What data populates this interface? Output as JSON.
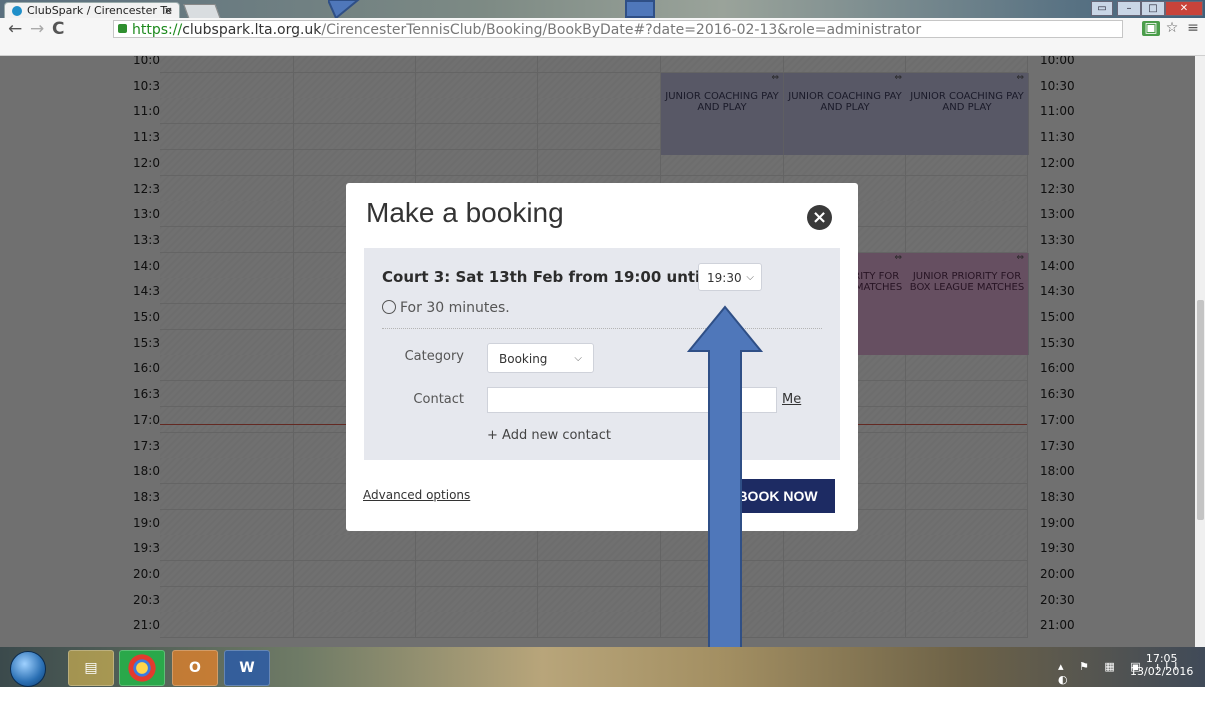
{
  "browser": {
    "tab_title": "ClubSpark / Cirencester Te",
    "tab_close": "×",
    "url_https": "https://",
    "url_domain": "clubspark.lta.org.uk",
    "url_path": "/CirencesterTennisClub/Booking/BookByDate#?date=2016-02-13&role=administrator"
  },
  "timetable": {
    "times": [
      "10:00",
      "10:30",
      "11:00",
      "11:30",
      "12:00",
      "12:30",
      "13:00",
      "13:30",
      "14:00",
      "14:30",
      "15:00",
      "15:30",
      "16:00",
      "16:30",
      "17:00",
      "17:30",
      "18:00",
      "18:30",
      "19:00",
      "19:30",
      "20:00",
      "20:30",
      "21:00"
    ],
    "sessions": {
      "coaching": [
        "JUNIOR COACHING PAY AND PLAY",
        "JUNIOR COACHING PAY AND PLAY",
        "JUNIOR COACHING PAY AND PLAY"
      ],
      "priority": [
        "JUNIOR PRIORITY FOR BOX LEAGUE MATCHES",
        "JUNIOR PRIORITY FOR BOX LEAGUE MATCHES"
      ]
    }
  },
  "modal": {
    "title": "Make a booking",
    "court_text": "Court 3: Sat 13th Feb from 19:00 until",
    "end_time": "19:30",
    "duration": "For 30 minutes.",
    "category_label": "Category",
    "category_value": "Booking",
    "contact_label": "Contact",
    "contact_value": "",
    "me_link": "Me",
    "add_contact": "+ Add new contact",
    "advanced_options": "Advanced options",
    "book_now": "BOOK NOW"
  },
  "taskbar": {
    "clock_time": "17:05",
    "clock_date": "13/02/2016"
  }
}
